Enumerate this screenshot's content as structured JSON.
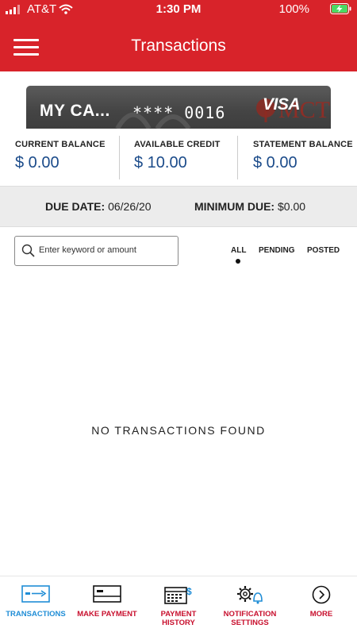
{
  "status_bar": {
    "carrier": "AT&T",
    "time": "1:30 PM",
    "battery": "100%"
  },
  "header": {
    "title": "Transactions",
    "menu_icon": "hamburger-menu-icon"
  },
  "card": {
    "name": "MY CA...",
    "number": "**** 0016",
    "network": "VISA",
    "issuer_mark": "MCT"
  },
  "balances": [
    {
      "label": "CURRENT BALANCE",
      "value": "$ 0.00"
    },
    {
      "label": "AVAILABLE CREDIT",
      "value": "$ 10.00"
    },
    {
      "label": "STATEMENT BALANCE",
      "value": "$ 0.00"
    }
  ],
  "due": {
    "date_label": "DUE DATE:",
    "date_value": "06/26/20",
    "min_label": "MINIMUM DUE:",
    "min_value": "$0.00"
  },
  "search": {
    "placeholder": "Enter keyword or amount",
    "value": ""
  },
  "filters": {
    "all": "ALL",
    "pending": "PENDING",
    "posted": "POSTED",
    "selected": "ALL"
  },
  "empty_message": "NO TRANSACTIONS FOUND",
  "bottom_nav": [
    {
      "label": "TRANSACTIONS",
      "icon": "transactions-icon",
      "active": true
    },
    {
      "label": "MAKE PAYMENT",
      "icon": "card-payment-icon",
      "active": false
    },
    {
      "label": "PAYMENT HISTORY",
      "icon": "calendar-dollar-icon",
      "active": false
    },
    {
      "label": "NOTIFICATION SETTINGS",
      "icon": "gear-bell-icon",
      "active": false
    },
    {
      "label": "MORE",
      "icon": "chevron-right-circle-icon",
      "active": false
    }
  ],
  "colors": {
    "brand_red": "#d8232a",
    "active_blue": "#1f8dd6",
    "value_blue": "#1b4b8a"
  }
}
